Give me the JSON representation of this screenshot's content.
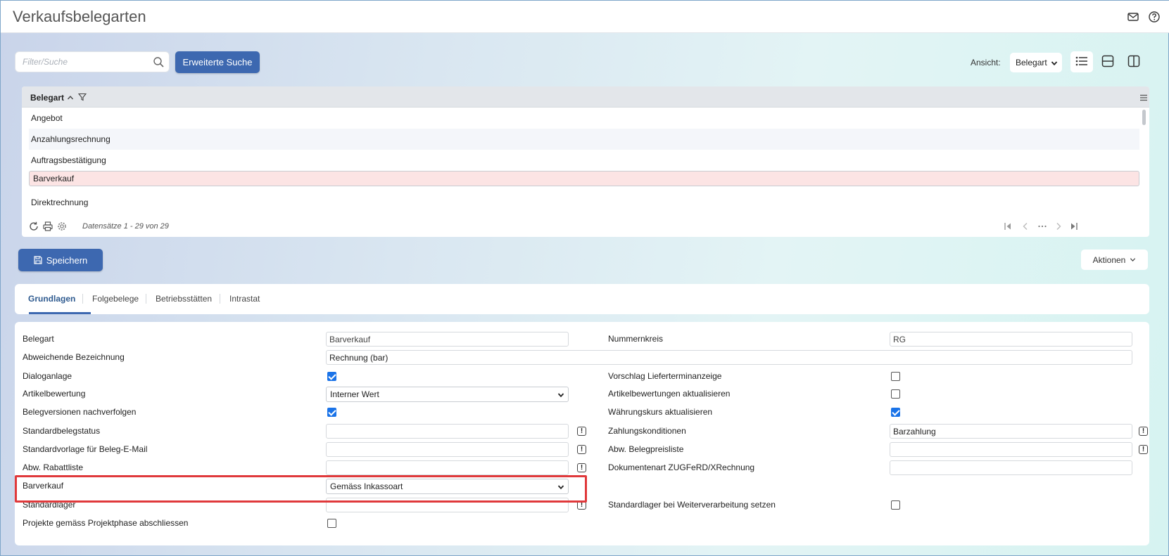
{
  "header": {
    "title": "Verkaufsbelegarten"
  },
  "toolbar": {
    "search_placeholder": "Filter/Suche",
    "advanced_search_label": "Erweiterte Suche",
    "view_label": "Ansicht:",
    "view_value": "Belegart"
  },
  "grid": {
    "column_header": "Belegart",
    "rows": [
      "Angebot",
      "Anzahlungsrechnung",
      "Auftragsbestätigung",
      "Barverkauf",
      "Direktrechnung"
    ],
    "selected_row": "Barverkauf",
    "records_text": "Datensätze 1 - 29 von 29"
  },
  "actions": {
    "save_label": "Speichern",
    "actions_label": "Aktionen"
  },
  "tabs": [
    "Grundlagen",
    "Folgebelege",
    "Betriebsstätten",
    "Intrastat"
  ],
  "form": {
    "belegart_label": "Belegart",
    "belegart_value": "Barverkauf",
    "nummernkreis_label": "Nummernkreis",
    "nummernkreis_value": "RG",
    "abw_bezeichnung_label": "Abweichende Bezeichnung",
    "abw_bezeichnung_value": "Rechnung (bar)",
    "dialoganlage_label": "Dialoganlage",
    "dialoganlage_checked": true,
    "vorschlag_label": "Vorschlag Lieferterminanzeige",
    "vorschlag_checked": false,
    "artikelbewertung_label": "Artikelbewertung",
    "artikelbewertung_value": "Interner Wert",
    "artikelbewertungen_akt_label": "Artikelbewertungen aktualisieren",
    "artikelbewertungen_akt_checked": false,
    "belegversionen_label": "Belegversionen nachverfolgen",
    "belegversionen_checked": true,
    "waehrungskurs_label": "Währungskurs aktualisieren",
    "waehrungskurs_checked": true,
    "standardbelegstatus_label": "Standardbelegstatus",
    "standardbelegstatus_value": "",
    "zahlungskonditionen_label": "Zahlungskonditionen",
    "zahlungskonditionen_value": "Barzahlung",
    "standardvorlage_label": "Standardvorlage für Beleg-E-Mail",
    "standardvorlage_value": "",
    "abw_belegpreisliste_label": "Abw. Belegpreisliste",
    "abw_belegpreisliste_value": "",
    "abw_rabattliste_label": "Abw. Rabattliste",
    "abw_rabattliste_value": "",
    "dokumentenart_label": "Dokumentenart ZUGFeRD/XRechnung",
    "dokumentenart_value": "",
    "barverkauf_label": "Barverkauf",
    "barverkauf_value": "Gemäss Inkassoart",
    "standardlager_label": "Standardlager",
    "standardlager_value": "",
    "standardlager_weiter_label": "Standardlager bei Weiterverarbeitung setzen",
    "standardlager_weiter_checked": false,
    "projekte_label": "Projekte gemäss Projektphase abschliessen",
    "projekte_checked": false,
    "info_glyph": "!"
  },
  "colors": {
    "primary": "#3d68b0",
    "selected_row": "#fce4e4",
    "checkbox_checked": "#1a73e8",
    "highlight_border": "#e0393b"
  }
}
